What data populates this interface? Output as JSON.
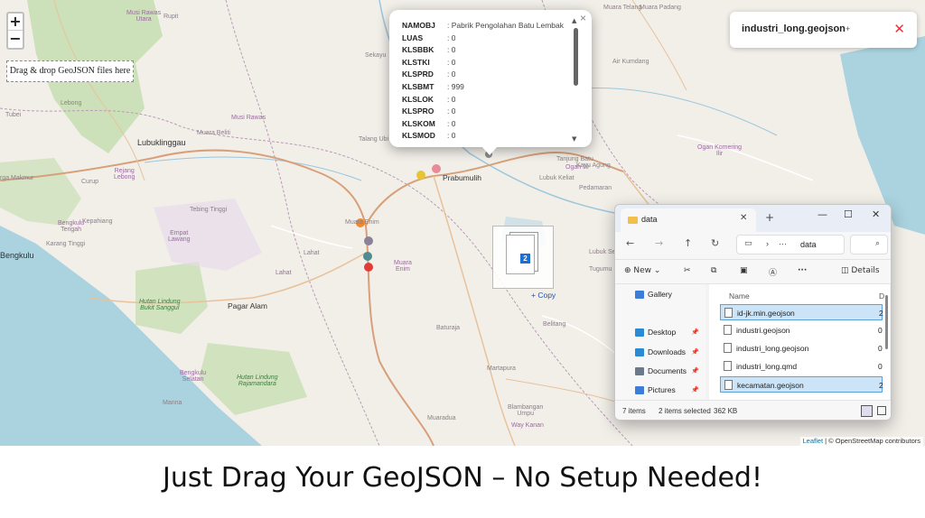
{
  "map": {
    "zoom_in": "+",
    "zoom_out": "−",
    "drop_hint": "Drag & drop GeoJSON files here",
    "labels": {
      "musi_rawas_utara": "Musi Rawas\nUtara",
      "rupit": "Rupit",
      "muara_telang": "Muara Telang",
      "muara_padang": "Muara Padang",
      "sekayu": "Sekayu",
      "air_kumdang": "Air Kumdang",
      "lebong": "Lebong",
      "tubei": "Tubei",
      "musi_rawas": "Musi Rawas",
      "muara_beliti": "Muara Beliti",
      "lubuklinggau": "Lubuklinggau",
      "talang_ubi": "Talang Ubi",
      "ogan_komering_ilir": "Ogan Komering\nIlir",
      "rejang_lebong": "Rejang\nLebong",
      "curup": "Curup",
      "arga_makmur": "rga Makmur",
      "tanjung_batu": "Tanjung Batu",
      "ogan_ilir": "Ogan Ilir",
      "kayu_agung": "Kayu Agung",
      "prabumulih": "Prabumulih",
      "lubuk_keliat": "Lubuk Keliat",
      "pedamaran": "Pedamaran",
      "tebing_tinggi": "Tebing Tinggi",
      "kepahiang": "Kepahiang",
      "bengkulu_tengah": "Bengkulu\nTengah",
      "empat_lawang": "Empat\nLawang",
      "karang_tinggi": "Karang Tinggi",
      "bengkulu": "Bengkulu",
      "muara_enim_city": "Muara Enim",
      "lahat_city": "Lahat",
      "lahat": "Lahat",
      "muara_enim": "Muara\nEnim",
      "lubuk_se": "Lubuk Se",
      "tugumu": "Tugumu",
      "hutan_bukit_sanggul": "Hutan Lindung\nBukit Sanggul",
      "pagar_alam": "Pagar Alam",
      "belitang": "Belitang",
      "baturaja": "Baturaja",
      "bengkulu_selatan": "Bengkulu\nSelatan",
      "hutan_rajamandara": "Hutan Lindung\nRajamandara",
      "martapura": "Martapura",
      "manna": "Manna",
      "muaradua": "Muaradua",
      "blambangan": "Blambangan\nUmpu",
      "way_kanan": "Way Kanan"
    }
  },
  "popup": {
    "rows": [
      {
        "key": "NAMOBJ",
        "value": ": Pabrik Pengolahan Batu Lembak"
      },
      {
        "key": "LUAS",
        "value": ": 0"
      },
      {
        "key": "KLSBBK",
        "value": ": 0"
      },
      {
        "key": "KLSTKI",
        "value": ": 0"
      },
      {
        "key": "KLSPRD",
        "value": ": 0"
      },
      {
        "key": "KLSBMT",
        "value": ": 999"
      },
      {
        "key": "KLSLOK",
        "value": ": 0"
      },
      {
        "key": "KLSPRO",
        "value": ": 0"
      },
      {
        "key": "KLSKOM",
        "value": ": 0"
      },
      {
        "key": "KLSMOD",
        "value": ": 0"
      }
    ],
    "close": "×",
    "scroll_up": "▲",
    "scroll_down": "▼"
  },
  "layer_panel": {
    "name": "industri_long.geojson",
    "plus": "+",
    "remove": "✕"
  },
  "drag": {
    "badge": "2",
    "copy_hint": "+ Copy"
  },
  "explorer": {
    "tab_title": "data",
    "tab_close": "✕",
    "new_tab": "+",
    "minimize": "—",
    "maximize": "☐",
    "close": "✕",
    "address_crumb": "data",
    "toolbar": {
      "new": "New",
      "details": "Details"
    },
    "sidebar": [
      {
        "label": "Gallery",
        "color": "#3b7dd8"
      },
      {
        "label": "Desktop",
        "color": "#2a8ad4"
      },
      {
        "label": "Downloads",
        "color": "#2a8ad4"
      },
      {
        "label": "Documents",
        "color": "#6a7a8a"
      },
      {
        "label": "Pictures",
        "color": "#3b7dd8"
      }
    ],
    "column_name": "Name",
    "column_size": "D",
    "files": [
      {
        "name": "id-jk.min.geojson",
        "size": "2",
        "selected": true
      },
      {
        "name": "industri.geojson",
        "size": "0",
        "selected": false
      },
      {
        "name": "industri_long.geojson",
        "size": "0",
        "selected": false
      },
      {
        "name": "industri_long.qmd",
        "size": "0",
        "selected": false
      },
      {
        "name": "kecamatan.geojson",
        "size": "2",
        "selected": true
      }
    ],
    "status": {
      "items": "7 items",
      "selected": "2 items selected",
      "size": "362 KB"
    }
  },
  "attribution": {
    "leaflet": "Leaflet",
    "osm": "| © OpenStreetMap contributors"
  },
  "caption": "Just Drag Your GeoJSON – No Setup Needed!",
  "colors": {
    "water": "#aad3df",
    "land": "#f2efe9",
    "forest": "#b8d9a4",
    "accent_blue": "#1a6fd1",
    "remove_red": "#e3343c"
  }
}
